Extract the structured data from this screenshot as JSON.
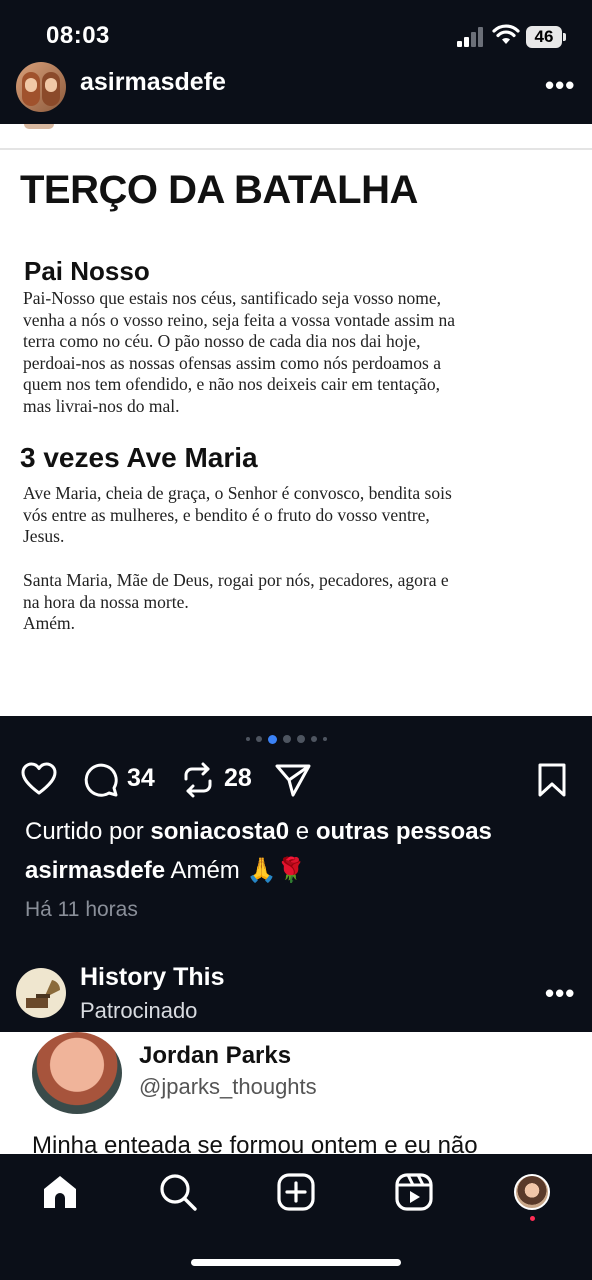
{
  "status_bar": {
    "time": "08:03",
    "battery": "46"
  },
  "post": {
    "username": "asirmasdefe",
    "image": {
      "title": "TERÇO DA BATALHA",
      "section1_heading": "Pai Nosso",
      "section1_text": "Pai-Nosso que estais nos céus, santificado seja vosso nome,\nvenha a nós o vosso reino, seja feita a vossa vontade assim na\nterra como no céu. O pão nosso de cada dia nos dai hoje,\nperdoai-nos as nossas ofensas assim como nós perdoamos a\nquem nos tem ofendido, e não nos deixeis cair em tentação,\nmas livrai-nos do mal.",
      "section2_heading": "3 vezes Ave Maria",
      "section2_text": "Ave Maria, cheia de graça, o Senhor é convosco, bendita sois\nvós entre as mulheres, e bendito é o fruto do vosso ventre,\nJesus.",
      "section2_text_b": "Santa Maria, Mãe de Deus, rogai por nós, pecadores, agora e\nna hora da nossa morte.\nAmém."
    },
    "carousel": {
      "total": 7,
      "active_index": 2
    },
    "comments_count": "34",
    "reposts_count": "28",
    "liked_by_prefix": "Curtido por ",
    "liked_by_user": "soniacosta0",
    "liked_by_mid": " e ",
    "liked_by_others": "outras pessoas",
    "caption_user": "asirmasdefe",
    "caption_text": " Amém 🙏🌹",
    "time_ago": "Há 11 horas"
  },
  "sponsored": {
    "name": "History This",
    "label": "Patrocinado",
    "card": {
      "name": "Jordan Parks",
      "handle": "@jparks_thoughts",
      "text": "Minha enteada se formou ontem e eu não"
    }
  },
  "icons": {
    "more": "more-icon",
    "like": "heart-icon",
    "comment": "comment-icon",
    "repost": "repost-icon",
    "share": "send-icon",
    "save": "bookmark-icon",
    "home": "home-icon",
    "search": "search-icon",
    "create": "create-icon",
    "reels": "reels-icon"
  }
}
